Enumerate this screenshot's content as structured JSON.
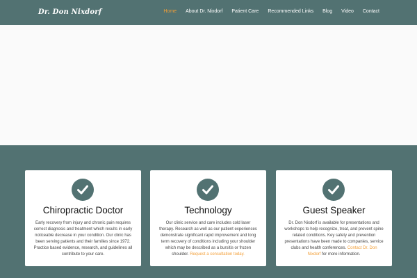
{
  "header": {
    "logo": "Dr. Don Nixdorf",
    "nav": [
      {
        "label": "Home",
        "active": true
      },
      {
        "label": "About Dr. Nixdorf",
        "active": false
      },
      {
        "label": "Patient Care",
        "active": false
      },
      {
        "label": "Recommended Links",
        "active": false
      },
      {
        "label": "Blog",
        "active": false
      },
      {
        "label": "Video",
        "active": false
      },
      {
        "label": "Contact",
        "active": false
      }
    ]
  },
  "colors": {
    "brand": "#527272",
    "accent": "#f29e36"
  },
  "cards": [
    {
      "icon": "checkmark-icon",
      "title": "Chiropractic Doctor",
      "text": "Early recovery from injury and chronic pain requires correct diagnosis and treatment which results in early noticeable decrease in your condition. Our clinic has been serving patients and their families since 1972. Practice based evidence, research, and guidelines all contribute to your care."
    },
    {
      "icon": "checkmark-icon",
      "title": "Technology",
      "text": "Our clinic service and care includes cold laser therapy. Research as well as our patient experiences demonstrate significant rapid improvement and long term recovery of conditions including your shoulder which may be described as a bursitis or frozen shoulder. ",
      "link": "Request a consultation today."
    },
    {
      "icon": "checkmark-icon",
      "title": "Guest Speaker",
      "text": "Dr. Don Nixdorf is available for presentations and workshops to help recognize, treat, and prevent spine related conditions. Key safety and prevention presentations have been made to companies, service clubs and health conferences. ",
      "link": "Contact Dr. Don Nixdorf",
      "text_after": " for more information."
    }
  ]
}
